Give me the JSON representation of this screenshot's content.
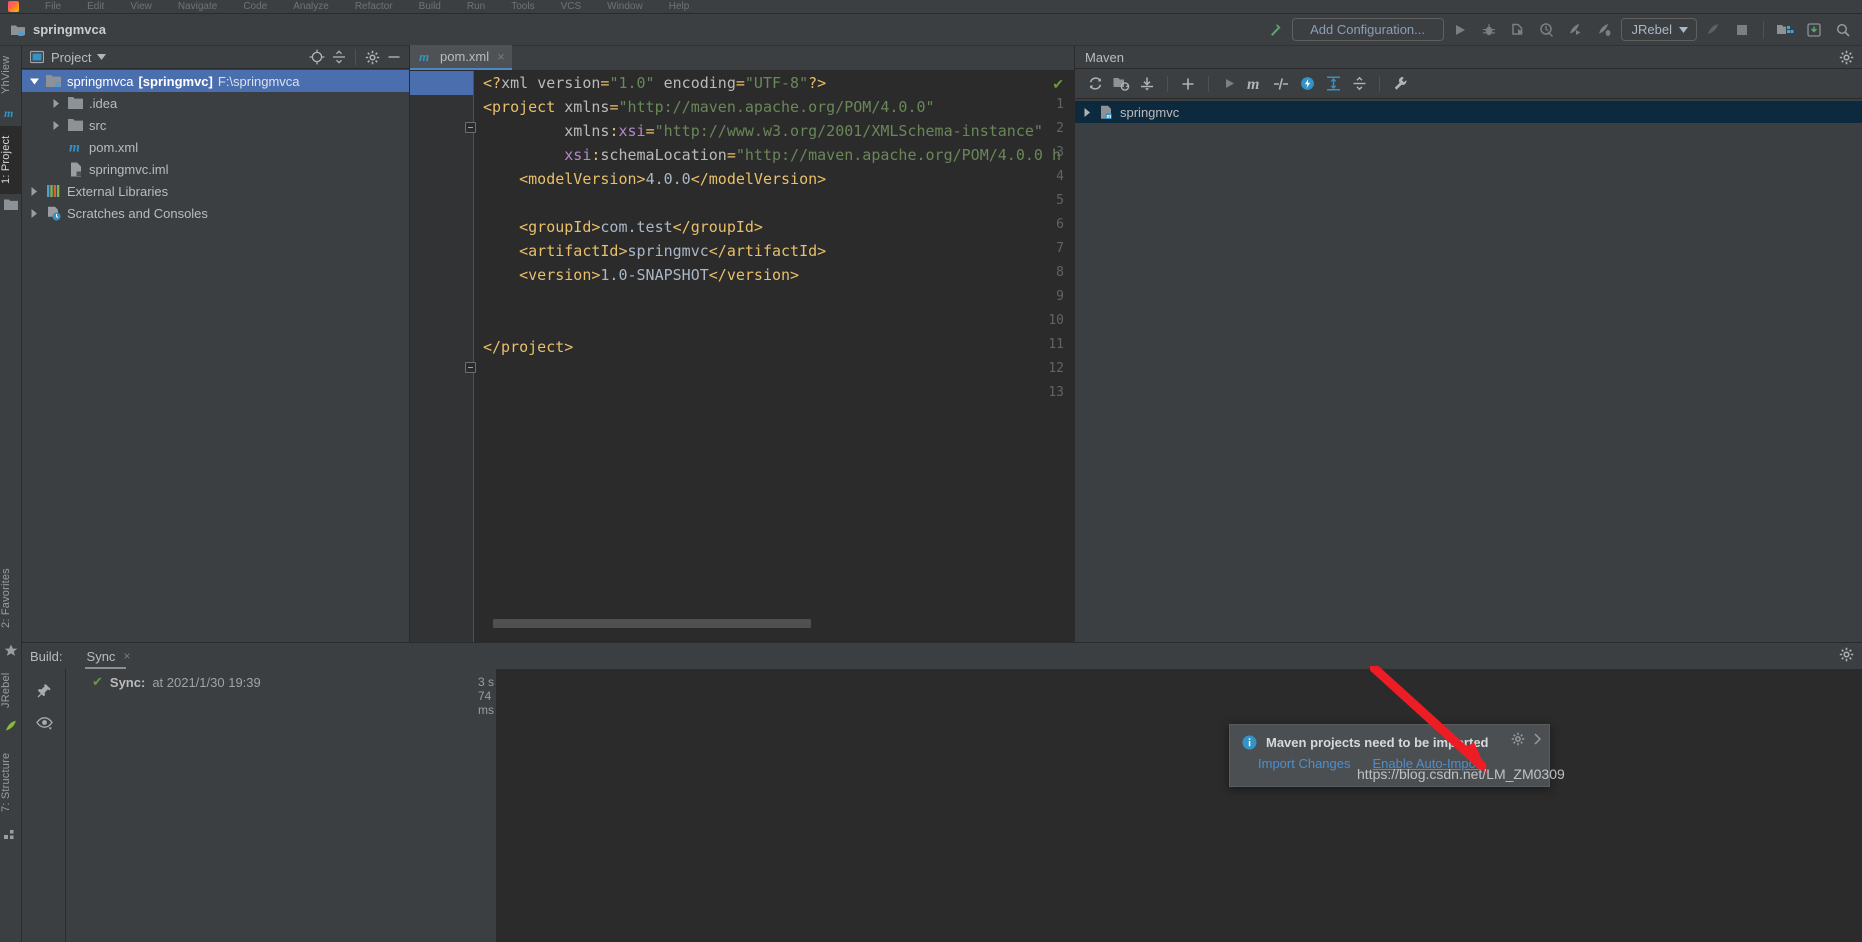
{
  "menubar": {
    "items": [
      "File",
      "Edit",
      "View",
      "Navigate",
      "Code",
      "Analyze",
      "Refactor",
      "Build",
      "Run",
      "Tools",
      "VCS",
      "Window",
      "Help"
    ]
  },
  "toolbar": {
    "project_name": "springmvca",
    "project_icon": "module-folder-icon",
    "build_icon": "hammer-icon",
    "run_config_label": "Add Configuration...",
    "run_icon": "run-triangle-icon",
    "debug_icon": "debug-bug-icon",
    "run_coverage_icon": "run-with-coverage-icon",
    "profiler_icon": "profiler-icon",
    "jrebel_run_icon": "jrebel-run-icon",
    "jrebel_debug_icon": "jrebel-debug-icon",
    "jrebel_label": "JRebel",
    "jrebel_chevron": "chevron-down-icon",
    "jrebel_rocket_icon": "jrebel-rocket-icon",
    "stop_icon": "stop-square-icon",
    "project_structure_icon": "project-structure-icon",
    "updates_icon": "updates-icon",
    "search_icon": "search-everywhere-icon"
  },
  "left_stripe": {
    "tabs": [
      {
        "label": "YhView",
        "selected": false
      },
      {
        "label": "1: Project",
        "selected": true
      },
      {
        "label": "2: Favorites",
        "selected": false
      },
      {
        "label": "JRebel",
        "selected": false
      },
      {
        "label": "7: Structure",
        "selected": false
      }
    ],
    "icons": [
      "maven-m-icon",
      "project-folder-icon",
      "favorites-star-icon",
      "jrebel-rocket-icon",
      "structure-icon"
    ]
  },
  "project_panel": {
    "title": "Project",
    "chevron": "chevron-down-icon",
    "locate_icon": "locate-target-icon",
    "collapse_icon": "collapse-all-icon",
    "settings_icon": "gear-icon",
    "hide_icon": "hide-minus-icon",
    "tree": [
      {
        "label": "springmvca",
        "bold_label": "[springmvc]",
        "path": "F:\\springmvca",
        "icon": "module-folder-icon",
        "arrow": "expanded",
        "depth": 0,
        "selected": true
      },
      {
        "label": ".idea",
        "icon": "folder-icon",
        "arrow": "collapsed",
        "depth": 1,
        "selected": false
      },
      {
        "label": "src",
        "icon": "folder-icon",
        "arrow": "collapsed",
        "depth": 1,
        "selected": false
      },
      {
        "label": "pom.xml",
        "icon": "maven-m-icon",
        "arrow": "none",
        "depth": 1,
        "selected": false
      },
      {
        "label": "springmvc.iml",
        "icon": "iml-file-icon",
        "arrow": "none",
        "depth": 1,
        "selected": false
      },
      {
        "label": "External Libraries",
        "icon": "libraries-icon",
        "arrow": "collapsed",
        "depth": 0,
        "selected": false
      },
      {
        "label": "Scratches and Consoles",
        "icon": "scratches-icon",
        "arrow": "collapsed",
        "depth": 0,
        "selected": false
      }
    ]
  },
  "editor": {
    "tab": {
      "label": "pom.xml",
      "icon": "maven-m-icon",
      "close": "×"
    },
    "inspection_status": "✔",
    "lines": [
      {
        "n": 1
      },
      {
        "n": 2
      },
      {
        "n": 3
      },
      {
        "n": 4
      },
      {
        "n": 5
      },
      {
        "n": 6
      },
      {
        "n": 7
      },
      {
        "n": 8
      },
      {
        "n": 9
      },
      {
        "n": 10
      },
      {
        "n": 11
      },
      {
        "n": 12
      },
      {
        "n": 13
      }
    ],
    "code_text": "<?xml version=\"1.0\" encoding=\"UTF-8\"?>\n<project xmlns=\"http://maven.apache.org/POM/4.0.0\"\n         xmlns:xsi=\"http://www.w3.org/2001/XMLSchema-instance\"\n         xsi:schemaLocation=\"http://maven.apache.org/POM/4.0.0 h\n    <modelVersion>4.0.0</modelVersion>\n\n    <groupId>com.test</groupId>\n    <artifactId>springmvc</artifactId>\n    <version>1.0-SNAPSHOT</version>\n\n\n</project>\n"
  },
  "maven_panel": {
    "title": "Maven",
    "settings_icon": "gear-icon",
    "toolbar_icons": [
      "reimport-refresh-icon",
      "generate-sources-icon",
      "download-sources-icon",
      "add-plus-icon",
      "run-triangle-icon",
      "maven-m-icon",
      "skip-tests-icon",
      "execute-goal-icon",
      "expand-all-icon",
      "collapse-all-icon",
      "maven-settings-wrench-icon"
    ],
    "tree": [
      {
        "label": "springmvc",
        "icon": "maven-project-icon",
        "arrow": "collapsed",
        "selected": true
      }
    ]
  },
  "build_panel": {
    "label": "Build:",
    "tab_label": "Sync",
    "tab_close": "×",
    "settings_icon": "gear-icon",
    "pin_icon": "pin-icon",
    "eye_icon": "eye-filter-icon",
    "entries": [
      {
        "status_icon": "✔",
        "title": "Sync:",
        "detail": "at 2021/1/30 19:39",
        "duration": "3 s 74 ms"
      }
    ]
  },
  "notification": {
    "info_icon": "info-circle-icon",
    "title": "Maven projects need to be imported",
    "actions": [
      {
        "label": "Import Changes",
        "underlined": false
      },
      {
        "label": "Enable Auto-Import",
        "underlined": true
      }
    ],
    "gear_icon": "gear-icon",
    "collapse_icon": "chevron-right-icon"
  },
  "watermark": {
    "text": "https://blog.csdn.net/LM_ZM0309"
  },
  "colors": {
    "accent_blue": "#4b6eaf",
    "panel_bg": "#3c3f41",
    "editor_bg": "#2b2b2b",
    "link_blue": "#4c8ed0",
    "success_green": "#6a9a3e",
    "string_green": "#6a8759",
    "tag_gold": "#e8bf6a",
    "arrow_red": "#ee1c25"
  }
}
